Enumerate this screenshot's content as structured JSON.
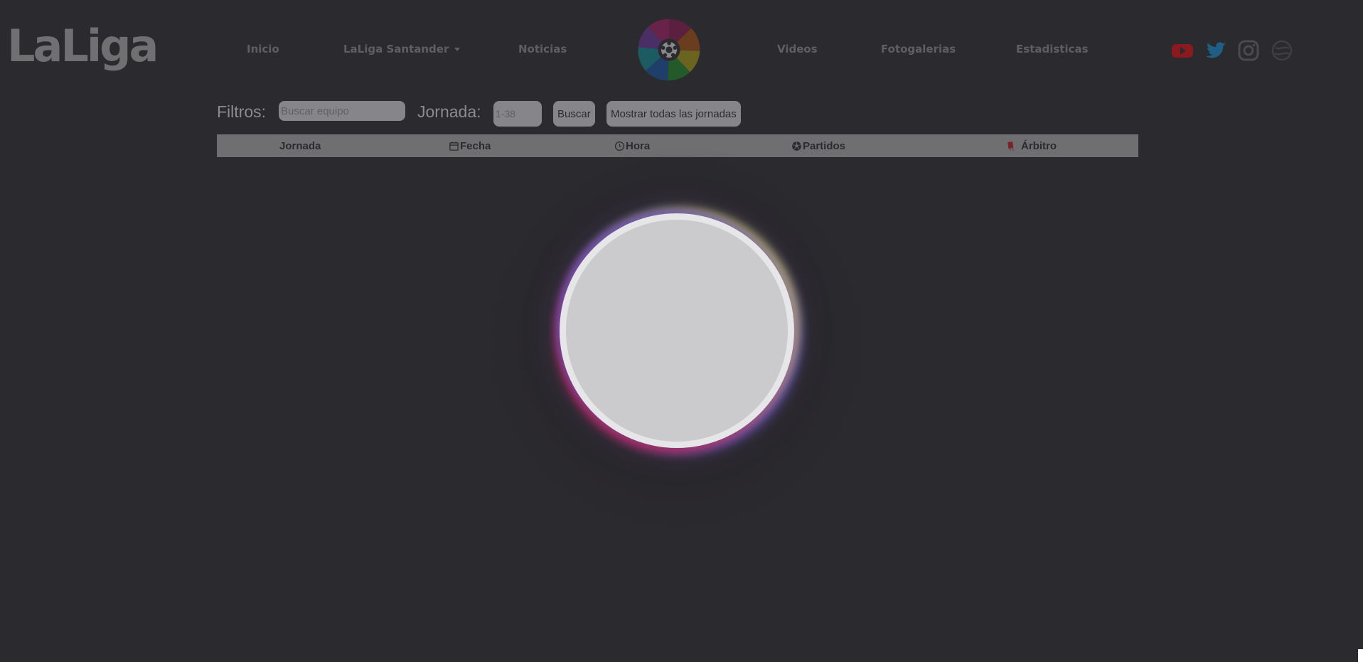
{
  "header": {
    "brand": "LaLiga",
    "nav": [
      {
        "label": "Inicio"
      },
      {
        "label": "LaLiga Santander",
        "has_dropdown": true
      },
      {
        "label": "Noticias"
      },
      {
        "label": "Videos"
      },
      {
        "label": "Fotogalerias"
      },
      {
        "label": "Estadisticas"
      }
    ],
    "social": [
      "youtube-icon",
      "twitter-icon",
      "instagram-icon",
      "web-icon"
    ]
  },
  "filters": {
    "label": "Filtros:",
    "search_placeholder": "Buscar equipo",
    "search_value": "",
    "jornada_label": "Jornada:",
    "jornada_placeholder": "1-38",
    "jornada_value": "",
    "search_button": "Buscar",
    "show_all_button": "Mostrar todas las jornadas"
  },
  "table": {
    "columns": [
      {
        "label": "Jornada",
        "icon": ""
      },
      {
        "label": "Fecha",
        "icon": "calendar-icon"
      },
      {
        "label": "Hora",
        "icon": "clock-icon"
      },
      {
        "label": "Partidos",
        "icon": "soccer-ball-icon"
      },
      {
        "label": "Árbitro",
        "icon": "red-card-icon"
      }
    ],
    "rows": []
  },
  "loader": {
    "state": "loading"
  },
  "colors": {
    "background": "#2b2a2e",
    "loader_accent_red": "#b4224e",
    "loader_accent_violet": "#7662d6",
    "loader_accent_yellow": "#c8c66a",
    "youtube": "#8a1a1e",
    "twitter": "#1f5f86"
  }
}
